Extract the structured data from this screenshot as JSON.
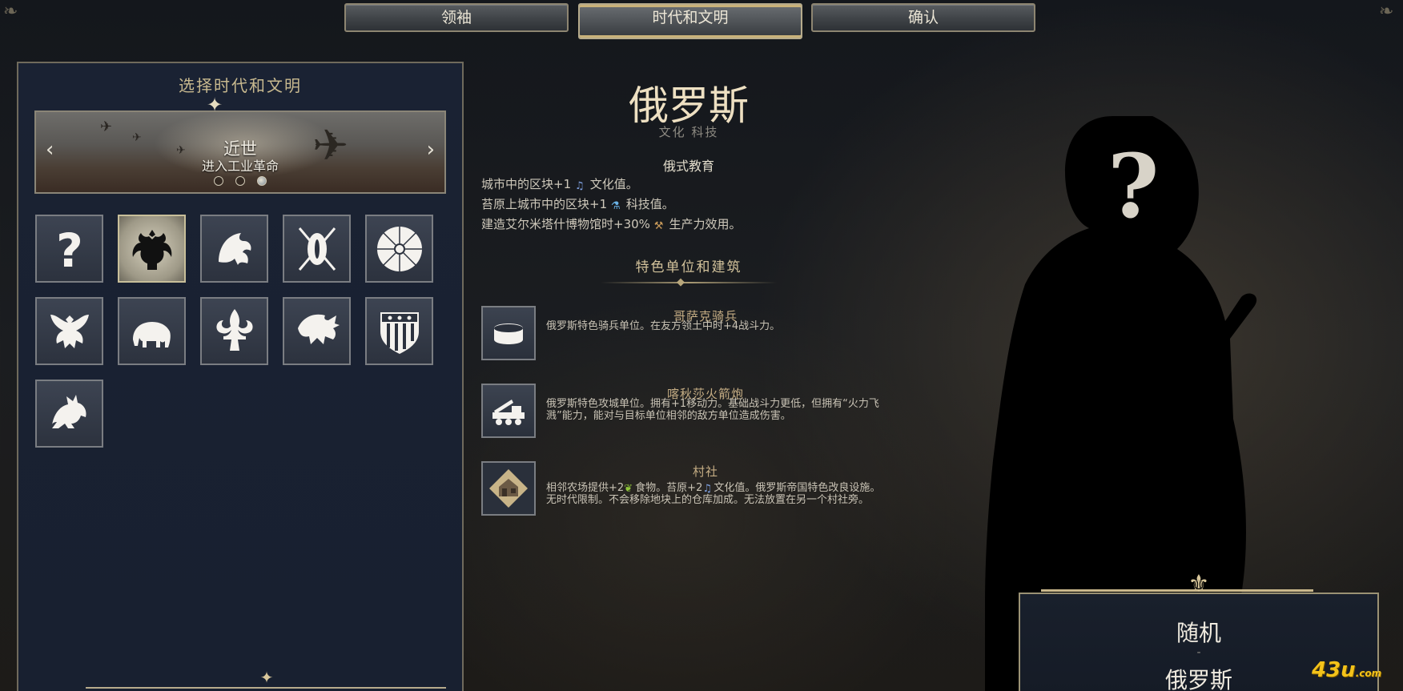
{
  "tabs": [
    {
      "label": "领袖"
    },
    {
      "label": "时代和文明",
      "active": true
    },
    {
      "label": "确认"
    }
  ],
  "left_panel": {
    "title": "选择时代和文明",
    "era": {
      "name": "近世",
      "subtitle": "进入工业革命",
      "page_count": 3,
      "active_page": 3
    },
    "civilizations": [
      {
        "icon": "question-mark-icon",
        "selected": false
      },
      {
        "icon": "double-headed-eagle-icon",
        "selected": true
      },
      {
        "icon": "griffin-icon",
        "selected": false
      },
      {
        "icon": "shield-spears-icon",
        "selected": false
      },
      {
        "icon": "chrysanthemum-icon",
        "selected": false
      },
      {
        "icon": "eagle-icon",
        "selected": false
      },
      {
        "icon": "elephant-icon",
        "selected": false
      },
      {
        "icon": "fleur-de-lis-icon",
        "selected": false
      },
      {
        "icon": "dragon-icon",
        "selected": false
      },
      {
        "icon": "stars-stripes-shield-icon",
        "selected": false
      },
      {
        "icon": "lion-icon",
        "selected": false
      }
    ]
  },
  "civ_detail": {
    "name": "俄罗斯",
    "tags": "文化 科技",
    "ability": {
      "name": "俄式教育",
      "lines": [
        {
          "pre": "城市中的区块+1",
          "icon": "culture-note-icon",
          "post": "文化值。"
        },
        {
          "pre": "苔原上城市中的区块+1",
          "icon": "science-flask-icon",
          "post": "科技值。"
        },
        {
          "pre": "建造艾尔米塔什博物馆时+30%",
          "icon": "production-hammer-icon",
          "post": "生产力效用。"
        }
      ]
    },
    "unique_section_title": "特色单位和建筑",
    "uniques": [
      {
        "name": "哥萨克骑兵",
        "icon": "cossack-hat-icon",
        "desc": "俄罗斯特色骑兵单位。在友方领土中时+4战斗力。"
      },
      {
        "name": "喀秋莎火箭炮",
        "icon": "rocket-truck-icon",
        "desc": "俄罗斯特色攻城单位。拥有+1移动力。基础战斗力更低，但拥有“火力飞溅”能力，能对与目标单位相邻的敌方单位造成伤害。"
      },
      {
        "name": "村社",
        "icon": "village-house-icon",
        "desc_pre": "相邻农场提供+2",
        "desc_icon1": "food-leaf-icon",
        "desc_mid": "食物。苔原+2",
        "desc_icon2": "culture-note-icon",
        "desc_post": "文化值。俄罗斯帝国特色改良设施。无时代限制。不会移除地块上的仓库加成。无法放置在另一个村社旁。"
      }
    ]
  },
  "leader_panel": {
    "leader": "随机",
    "separator": "-",
    "civ": "俄罗斯"
  },
  "watermark": {
    "main": "43u",
    "suffix": ".com"
  },
  "colors": {
    "accent_gold": "#c9b78b",
    "panel_bg": "#1a2233",
    "watermark": "#f3c21a"
  }
}
